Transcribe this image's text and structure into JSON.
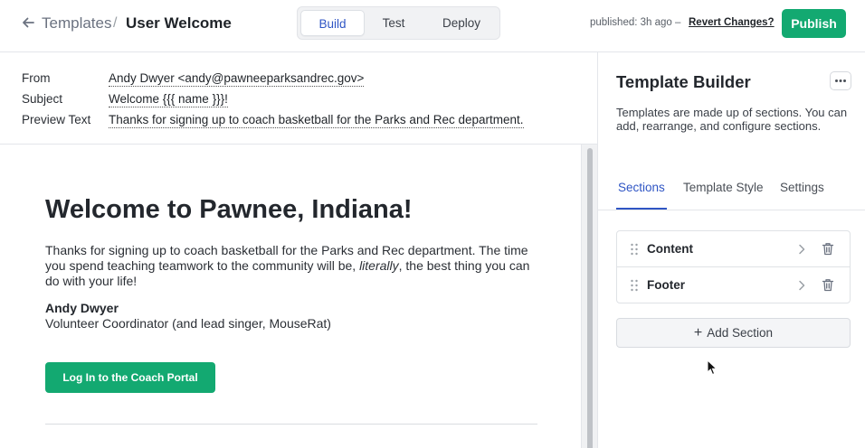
{
  "header": {
    "breadcrumb_parent": "Templates",
    "breadcrumb_separator": "/",
    "breadcrumb_current": "User Welcome",
    "modes": [
      {
        "label": "Build",
        "active": true
      },
      {
        "label": "Test",
        "active": false
      },
      {
        "label": "Deploy",
        "active": false
      }
    ],
    "published_status": "published: 3h ago –",
    "revert_label": "Revert Changes?",
    "publish_label": "Publish"
  },
  "meta": {
    "from_label": "From",
    "from_value": "Andy Dwyer <andy@pawneeparksandrec.gov>",
    "subject_label": "Subject",
    "subject_value": "Welcome {{{ name }}}!",
    "preview_label": "Preview Text",
    "preview_value": "Thanks for signing up to coach basketball for the Parks and Rec department."
  },
  "email": {
    "heading": "Welcome to Pawnee, Indiana!",
    "body_before": "Thanks for signing up to coach basketball for the Parks and Rec department. The time you spend teaching teamwork to the community will be, ",
    "body_emphasis": "literally",
    "body_after": ", the best thing you can do with your life!",
    "signature_name": "Andy Dwyer",
    "signature_title": "Volunteer Coordinator (and lead singer, MouseRat)",
    "cta_label": "Log In to the Coach Portal"
  },
  "panel": {
    "title": "Template Builder",
    "description": "Templates are made up of sections. You can add, rearrange, and configure sections.",
    "tabs": [
      {
        "label": "Sections",
        "active": true
      },
      {
        "label": "Template Style",
        "active": false
      },
      {
        "label": "Settings",
        "active": false
      }
    ],
    "sections": [
      {
        "label": "Content"
      },
      {
        "label": "Footer"
      }
    ],
    "add_section_label": "Add Section",
    "add_section_icon": "+"
  },
  "colors": {
    "accent_blue": "#2f55c4",
    "publish_green": "#13a971"
  }
}
